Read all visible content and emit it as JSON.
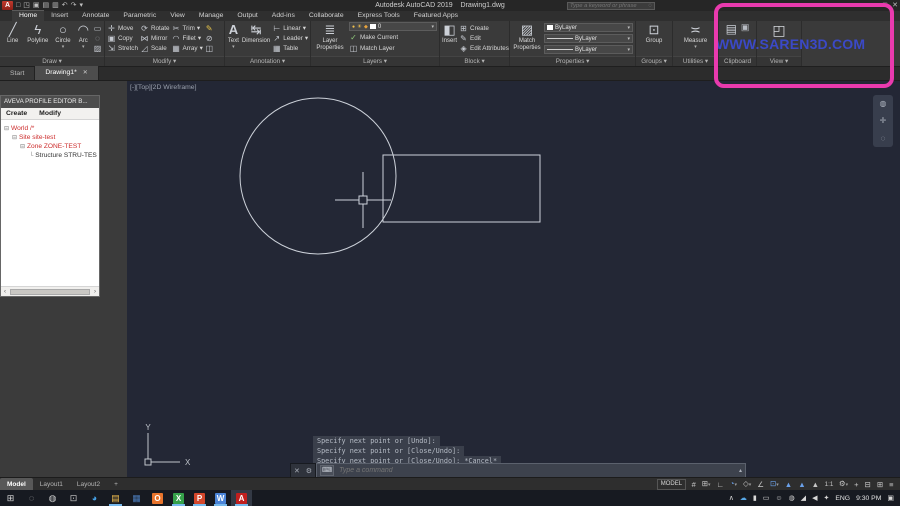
{
  "colors": {
    "canvas_bg": "#232735",
    "geometry_line": "#cdd2da",
    "highlight_pink": "#e93aae",
    "watermark_blue": "#3b49c7",
    "tree_red": "#cc2b2b",
    "status_accent_blue": "#6aa0e8",
    "taskbar_underline": "#76b9ed"
  },
  "titlebar": {
    "app_title": "Autodesk AutoCAD 2019",
    "doc_title": "Drawing1.dwg",
    "search_placeholder": "Type a keyword or phrase",
    "search_icon_glyph": "◌",
    "window_controls": [
      "–",
      "□",
      "✕"
    ],
    "qat_icons": [
      {
        "name": "app-logo-icon",
        "glyph": "A"
      },
      {
        "name": "new-file-icon",
        "glyph": "□"
      },
      {
        "name": "open-file-icon",
        "glyph": "◳"
      },
      {
        "name": "save-icon",
        "glyph": "▣"
      },
      {
        "name": "save-as-icon",
        "glyph": "▤"
      },
      {
        "name": "plot-icon",
        "glyph": "▥"
      },
      {
        "name": "undo-icon",
        "glyph": "↶"
      },
      {
        "name": "redo-icon",
        "glyph": "↷"
      },
      {
        "name": "qat-dropdown-icon",
        "glyph": "▾"
      }
    ]
  },
  "ribbon": {
    "tabs": [
      "Home",
      "Insert",
      "Annotate",
      "Parametric",
      "View",
      "Manage",
      "Output",
      "Add-ins",
      "Collaborate",
      "Express Tools",
      "Featured Apps"
    ],
    "active_tab": "Home",
    "panels": [
      {
        "label": "Draw"
      },
      {
        "label": "Modify"
      },
      {
        "label": "Annotation"
      },
      {
        "label": "Layers"
      },
      {
        "label": "Block"
      },
      {
        "label": "Properties"
      },
      {
        "label": "Groups"
      },
      {
        "label": "Utilities"
      },
      {
        "label": "Clipboard"
      },
      {
        "label": "View"
      }
    ],
    "draw": {
      "items": [
        {
          "label": "Line",
          "glyph": "╱"
        },
        {
          "label": "Polyline",
          "glyph": "ϟ"
        },
        {
          "label": "Circle",
          "glyph": "○"
        },
        {
          "label": "Arc",
          "glyph": "◠"
        }
      ],
      "extra": [
        {
          "glyph": "▭"
        },
        {
          "glyph": "◌"
        },
        {
          "glyph": "▨"
        }
      ]
    },
    "modify": {
      "col1": [
        {
          "label": "Move",
          "glyph": "✛"
        },
        {
          "label": "Copy",
          "glyph": "▣"
        },
        {
          "label": "Stretch",
          "glyph": "⇲"
        }
      ],
      "col2": [
        {
          "label": "Rotate",
          "glyph": "⟳"
        },
        {
          "label": "Mirror",
          "glyph": "⋈"
        },
        {
          "label": "Scale",
          "glyph": "◿"
        }
      ],
      "col3": [
        {
          "label": "Trim",
          "glyph": "✂"
        },
        {
          "label": "Fillet",
          "glyph": "◠"
        },
        {
          "label": "Array",
          "glyph": "▦"
        }
      ],
      "extra": [
        {
          "glyph": "✎"
        },
        {
          "glyph": "⊘"
        },
        {
          "glyph": "◫"
        }
      ]
    },
    "annotation": {
      "big": [
        {
          "label": "Text",
          "glyph": "A"
        },
        {
          "label": "Dimension",
          "glyph": "↹"
        }
      ],
      "items": [
        {
          "label": "Linear",
          "glyph": "⊢"
        },
        {
          "label": "Leader",
          "glyph": "↗"
        },
        {
          "label": "Table",
          "glyph": "▦"
        }
      ]
    },
    "layers": {
      "big": {
        "label": "Layer Properties",
        "glyph": "≣"
      },
      "dropdown": {
        "bulb": "●",
        "sun": "☀",
        "lock": "◆",
        "value": "0"
      },
      "items": [
        {
          "label": "Make Current",
          "glyph": "✓"
        },
        {
          "label": "Match Layer",
          "glyph": "◫"
        }
      ]
    },
    "block": {
      "big": {
        "label": "Insert",
        "glyph": "◧"
      },
      "items": [
        {
          "label": "Create",
          "glyph": "⊞"
        },
        {
          "label": "Edit",
          "glyph": "✎"
        },
        {
          "label": "Edit Attributes",
          "glyph": "◈"
        }
      ]
    },
    "properties": {
      "big": {
        "label": "Match Properties",
        "glyph": "▨"
      },
      "rows": [
        {
          "swatch": "square",
          "value": "ByLayer"
        },
        {
          "swatch": "line",
          "value": "ByLayer"
        },
        {
          "swatch": "line",
          "value": "ByLayer"
        }
      ]
    },
    "groups": {
      "big": {
        "label": "Group",
        "glyph": "⊡"
      }
    },
    "utilities": {
      "big": {
        "label": "Measure",
        "glyph": "≍"
      }
    },
    "clipboard": {
      "icons": [
        {
          "name": "paste-icon",
          "glyph": "▤"
        },
        {
          "name": "copy-clip-icon",
          "glyph": "▣"
        }
      ]
    },
    "view": {
      "icon": {
        "name": "view-tool-icon",
        "glyph": "◰"
      }
    }
  },
  "file_tabs": {
    "tabs": [
      {
        "label": "Start",
        "active": false
      },
      {
        "label": "Drawing1*",
        "active": true,
        "close_glyph": "✕"
      }
    ]
  },
  "palette": {
    "title": "AVEVA PROFILE EDITOR B...",
    "menus": [
      "Create",
      "Modify"
    ],
    "tree": [
      {
        "label": "World /*",
        "level": 0,
        "expander": "⊟",
        "red": true
      },
      {
        "label": "Site site-test",
        "level": 1,
        "expander": "⊟",
        "red": true
      },
      {
        "label": "Zone ZONE-TEST",
        "level": 2,
        "expander": "⊟",
        "red": true
      },
      {
        "label": "Structure STRU-TES",
        "level": 3,
        "expander": "└",
        "red": false
      }
    ],
    "hscroll_arrows": [
      "‹",
      "›"
    ]
  },
  "viewport": {
    "controls_label": "[-][Top][2D Wireframe]",
    "ucs_x": "X",
    "ucs_y": "Y",
    "navbar_icons": [
      {
        "glyph": "◍"
      },
      {
        "glyph": "✛"
      },
      {
        "glyph": "◌"
      }
    ]
  },
  "command": {
    "history": [
      "Specify next point or [Undo]:",
      "Specify next point or [Close/Undo]:",
      "Specify next point or [Close/Undo]: *Cancel*"
    ],
    "prompt_placeholder": "Type a command",
    "close_glyph": "✕",
    "wrench_glyph": "⚙",
    "kbd_glyph": "⌨",
    "expand_glyph": "▴"
  },
  "status": {
    "layout_tabs": [
      "Model",
      "Layout1",
      "Layout2",
      "+"
    ],
    "model_badge": "MODEL",
    "icons_a": [
      {
        "name": "grid-icon",
        "glyph": "#",
        "blue": false
      },
      {
        "name": "snap-icon",
        "glyph": "⊞",
        "dd": true
      },
      {
        "name": "ortho-icon",
        "glyph": "∟"
      },
      {
        "name": "polar-tracking-icon",
        "glyph": "◔",
        "blue": true,
        "dd": true
      },
      {
        "name": "isodraft-icon",
        "glyph": "◇",
        "dd": true
      },
      {
        "name": "osnap-tracking-icon",
        "glyph": "∠"
      },
      {
        "name": "osnap-icon",
        "glyph": "⊡",
        "blue": true,
        "dd": true
      },
      {
        "name": "annotation-visibility-icon",
        "glyph": "▲",
        "blue": true
      },
      {
        "name": "annotation-autoscale-icon",
        "glyph": "▲",
        "blue": true
      },
      {
        "name": "annotation-scale-icon",
        "glyph": "▲"
      }
    ],
    "scale": "1:1",
    "icons_b": [
      {
        "name": "workspace-gear-icon",
        "glyph": "⚙",
        "dd": true
      },
      {
        "name": "plus-icon",
        "glyph": "+"
      },
      {
        "name": "isolate-objects-icon",
        "glyph": "⊟"
      },
      {
        "name": "hardware-accel-icon",
        "glyph": "⊞"
      },
      {
        "name": "clean-screen-icon",
        "glyph": "≡"
      }
    ]
  },
  "taskbar": {
    "icons": [
      {
        "name": "start-button",
        "glyph": "⊞",
        "color": "#d6d6d6"
      },
      {
        "name": "search-icon",
        "glyph": "◌",
        "color": "#c9c9c9"
      },
      {
        "name": "cortana-icon",
        "glyph": "◍",
        "color": "#cfcfcf"
      },
      {
        "name": "task-view-icon",
        "glyph": "⊡",
        "color": "#c9c9c9"
      },
      {
        "name": "edge-icon",
        "glyph": "◕",
        "color": "#45a2e8"
      },
      {
        "name": "file-explorer-icon",
        "glyph": "▤",
        "color": "#f5c14e",
        "open": true
      },
      {
        "name": "blue-folder-app-icon",
        "glyph": "▦",
        "color": "#4a7ab8"
      },
      {
        "name": "orange-app-icon",
        "glyph": "O",
        "bg": "#e8742c"
      },
      {
        "name": "excel-icon",
        "glyph": "X",
        "bg": "#35a14a",
        "open": true
      },
      {
        "name": "powerpoint-icon",
        "glyph": "P",
        "bg": "#d4472c",
        "open": true
      },
      {
        "name": "word-icon",
        "glyph": "W",
        "bg": "#4a84d8",
        "open": true
      },
      {
        "name": "autocad-taskbar-icon",
        "glyph": "A",
        "bg": "#c01f1f",
        "open": true,
        "active": true
      }
    ],
    "tray": [
      {
        "name": "tray-expand-icon",
        "glyph": "∧"
      },
      {
        "name": "onedrive-icon",
        "glyph": "☁"
      },
      {
        "name": "mic-icon",
        "glyph": "▮"
      },
      {
        "name": "battery-icon",
        "glyph": "▭"
      },
      {
        "name": "user-icon",
        "glyph": "☺"
      },
      {
        "name": "status-circle-icon",
        "glyph": "◍"
      },
      {
        "name": "network-icon",
        "glyph": "◢"
      },
      {
        "name": "volume-icon",
        "glyph": "◀"
      },
      {
        "name": "link-icon",
        "glyph": "✦"
      }
    ],
    "lang": "ENG",
    "time": "9:30 PM",
    "notification_glyph": "▣"
  },
  "watermark": {
    "text": "WWW.SAREN3D.COM"
  }
}
